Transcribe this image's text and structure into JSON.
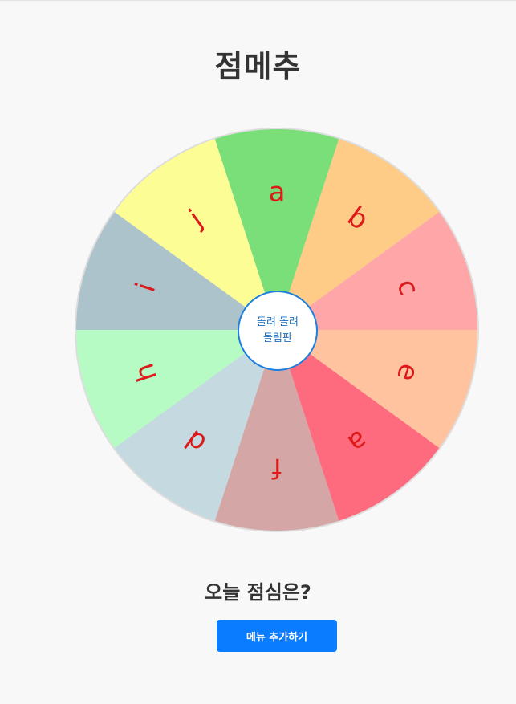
{
  "page": {
    "title": "점메추"
  },
  "wheel": {
    "segments": [
      {
        "label": "a",
        "color": "#7adf78"
      },
      {
        "label": "b",
        "color": "#ffcc88"
      },
      {
        "label": "c",
        "color": "#ffa7a8"
      },
      {
        "label": "e",
        "color": "#ffc49f"
      },
      {
        "label": "a",
        "color": "#ff6b7e"
      },
      {
        "label": "f",
        "color": "#d4a7a6"
      },
      {
        "label": "d",
        "color": "#c4d9e0"
      },
      {
        "label": "h",
        "color": "#b6fac4"
      },
      {
        "label": "i",
        "color": "#adc3cc"
      },
      {
        "label": "j",
        "color": "#fdfd96"
      }
    ],
    "label_color": "#dd1a1a",
    "hub_line1": "돌려 돌려",
    "hub_line2": "돌림판"
  },
  "result": {
    "question": "오늘 점심은?"
  },
  "actions": {
    "add_menu_label": "메뉴 추가하기"
  }
}
